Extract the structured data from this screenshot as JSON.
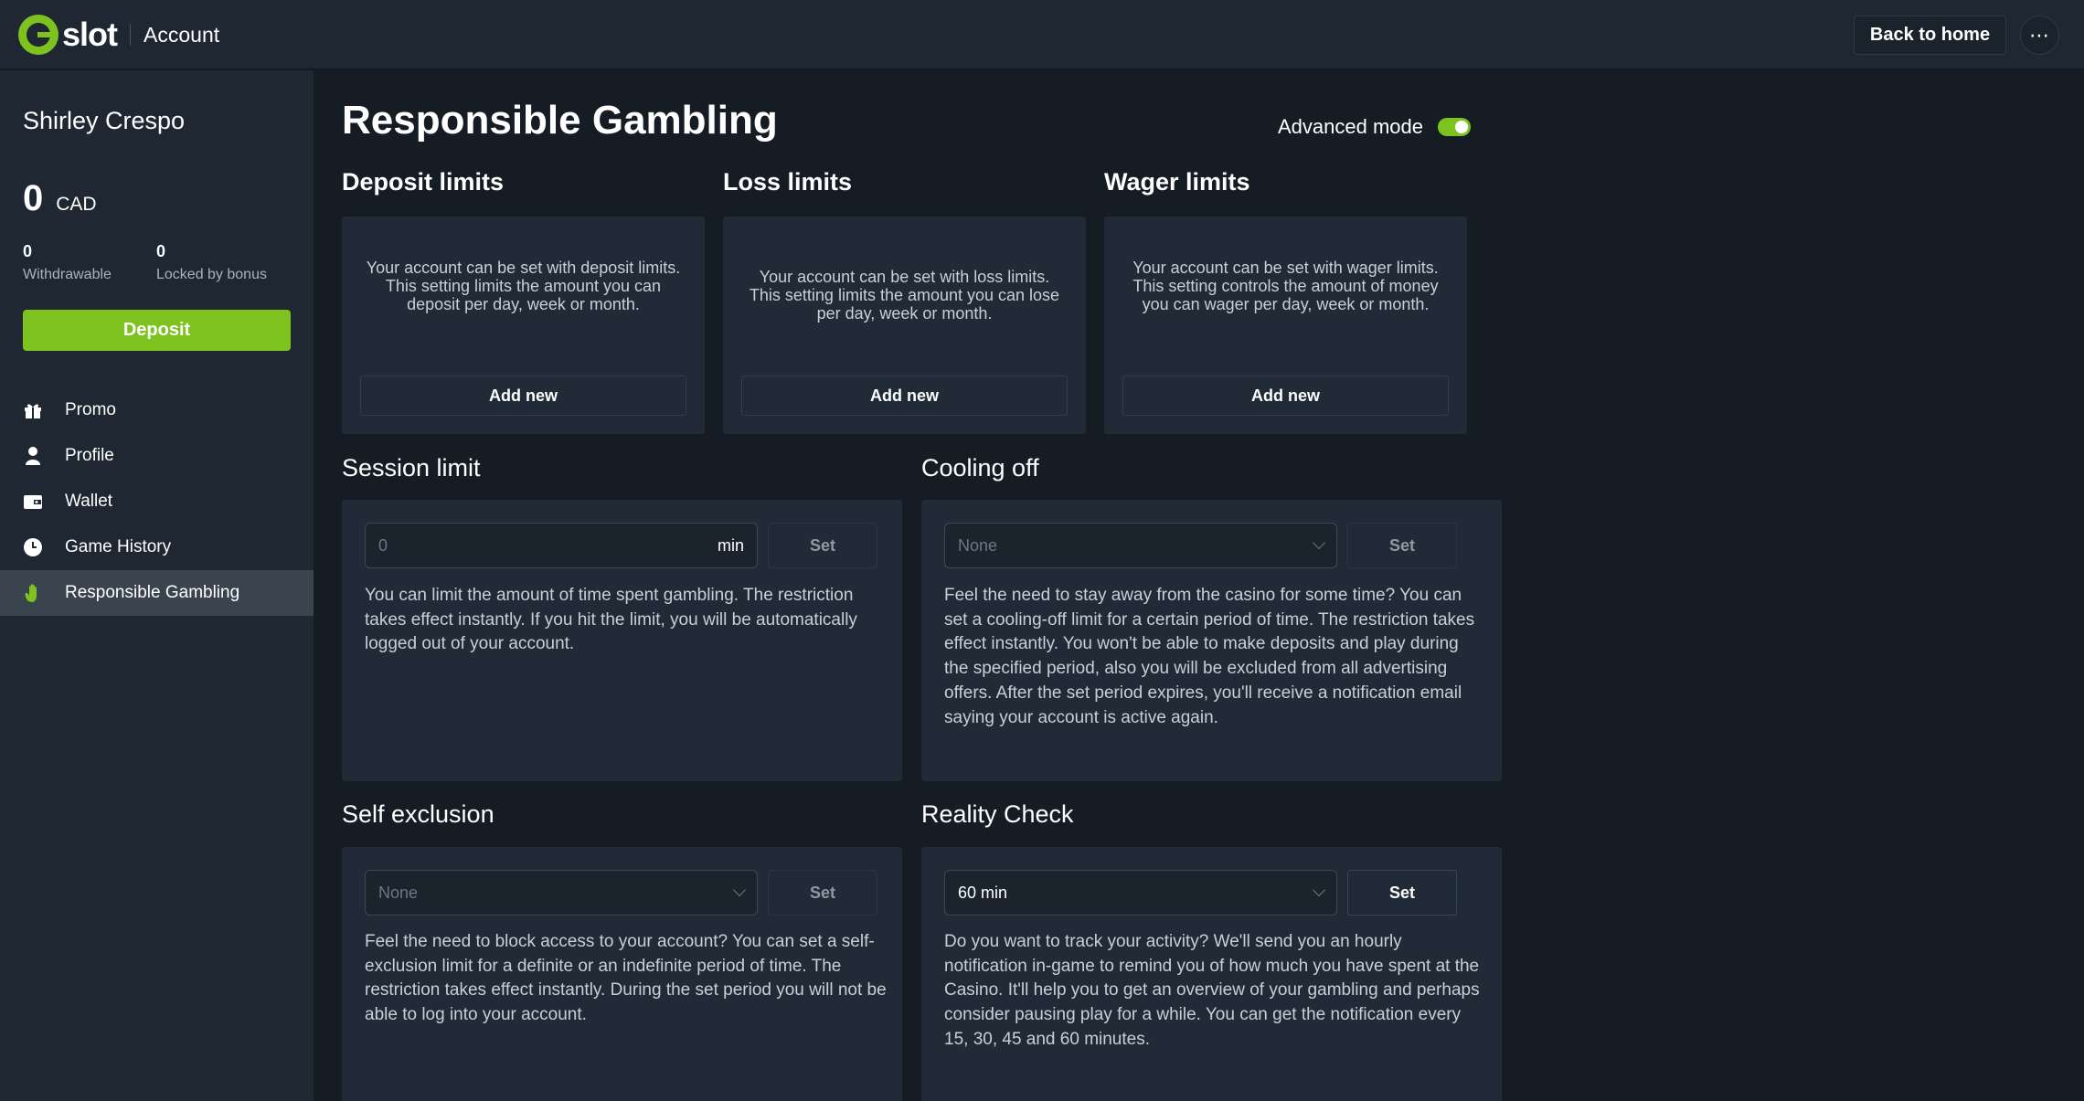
{
  "header": {
    "brand": "slot",
    "section": "Account",
    "back_label": "Back to home",
    "more_label": "⋯"
  },
  "sidebar": {
    "user_name": "Shirley Crespo",
    "balance": "0",
    "currency": "CAD",
    "withdrawable_value": "0",
    "withdrawable_label": "Withdrawable",
    "locked_value": "0",
    "locked_label": "Locked by bonus",
    "deposit_label": "Deposit",
    "items": [
      {
        "label": "Promo",
        "icon": "gift-icon"
      },
      {
        "label": "Profile",
        "icon": "user-icon"
      },
      {
        "label": "Wallet",
        "icon": "wallet-icon"
      },
      {
        "label": "Game History",
        "icon": "clock-icon"
      },
      {
        "label": "Responsible Gambling",
        "icon": "hand-icon",
        "active": true
      }
    ]
  },
  "main": {
    "title": "Responsible Gambling",
    "advanced_mode_label": "Advanced mode",
    "advanced_mode_on": true,
    "limits": [
      {
        "title": "Deposit limits",
        "desc": "Your account can be set with deposit limits. This setting limits the amount you can deposit per day, week or month.",
        "button": "Add new"
      },
      {
        "title": "Loss limits",
        "desc": "Your account can be set with loss limits. This setting limits the amount you can lose per day, week or month.",
        "button": "Add new"
      },
      {
        "title": "Wager limits",
        "desc": "Your account can be set with wager limits. This setting controls the amount of money you can wager per day, week or month.",
        "button": "Add new"
      }
    ],
    "session": {
      "title": "Session limit",
      "input_placeholder": "0",
      "input_suffix": "min",
      "button": "Set",
      "desc": "You can limit the amount of time spent gambling. The restriction takes effect instantly. If you hit the limit, you will be automatically logged out of your account."
    },
    "cooling": {
      "title": "Cooling off",
      "select_value": "None",
      "button": "Set",
      "desc": "Feel the need to stay away from the casino for some time? You can set a cooling-off limit for a certain period of time. The restriction takes effect instantly. You won't be able to make deposits and play during the specified period, also you will be excluded from all advertising offers. After the set period expires, you'll receive a notification email saying your account is active again."
    },
    "self_exclusion": {
      "title": "Self exclusion",
      "select_value": "None",
      "button": "Set",
      "desc": "Feel the need to block access to your account? You can set a self-exclusion limit for a definite or an indefinite period of time. The restriction takes effect instantly. During the set period you will not be able to log into your account."
    },
    "reality": {
      "title": "Reality Check",
      "select_value": "60 min",
      "button": "Set",
      "desc": "Do you want to track your activity? We'll send you an hourly notification in-game to remind you of how much you have spent at the Casino. It'll help you to get an overview of your gambling and perhaps consider pausing play for a while. You can get the notification every 15, 30, 45 and 60 minutes."
    }
  },
  "colors": {
    "accent": "#7dc21e",
    "background": "#151c24",
    "panel": "#1e2732",
    "card": "#212b37"
  }
}
